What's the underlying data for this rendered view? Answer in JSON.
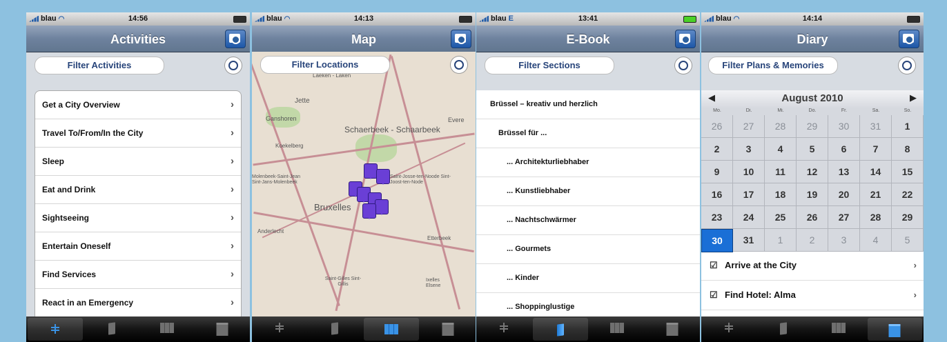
{
  "screens": [
    {
      "carrier": "blau",
      "time": "14:56",
      "title": "Activities",
      "filter": "Filter Activities",
      "items": [
        "Get a City Overview",
        "Travel To/From/In the City",
        "Sleep",
        "Eat and Drink",
        "Sightseeing",
        "Entertain Oneself",
        "Find Services",
        "React in an Emergency"
      ]
    },
    {
      "carrier": "blau",
      "time": "14:13",
      "title": "Map",
      "filter": "Filter Locations",
      "map_labels": [
        "Laeken - Laken",
        "Jette",
        "Ganshoren",
        "Schaerbeek - Schaarbeek",
        "Evere",
        "Koekelberg",
        "Molenbeek-Saint-Jean Sint-Jans-Molenbeek",
        "Saint-Josse-ten-Noode Sint-Joost-ten-Node",
        "Bruxelles",
        "Anderlecht",
        "Etterbeek",
        "Saint-Gilles Sint-Gillis",
        "Ixelles Elsene"
      ]
    },
    {
      "carrier": "blau",
      "network": "E",
      "time": "13:41",
      "title": "E-Book",
      "filter": "Filter Sections",
      "sections": [
        "Brüssel – kreativ und herzlich",
        "Brüssel für ...",
        "... Architekturliebhaber",
        "... Kunstliebhaber",
        "... Nachtschwärmer",
        "... Gourmets",
        "... Kinder",
        "... Shoppinglustige"
      ]
    },
    {
      "carrier": "blau",
      "time": "14:14",
      "title": "Diary",
      "filter": "Filter Plans & Memories",
      "calendar": {
        "month": "August 2010",
        "prev": "◀",
        "next": "▶",
        "weekdays": [
          "Mo.",
          "Di.",
          "Mi.",
          "Do.",
          "Fr.",
          "Sa.",
          "So."
        ],
        "days": [
          "26",
          "27",
          "28",
          "29",
          "30",
          "31",
          "1",
          "2",
          "3",
          "4",
          "5",
          "6",
          "7",
          "8",
          "9",
          "10",
          "11",
          "12",
          "13",
          "14",
          "15",
          "16",
          "17",
          "18",
          "19",
          "20",
          "21",
          "22",
          "23",
          "24",
          "25",
          "26",
          "27",
          "28",
          "29",
          "30",
          "31",
          "1",
          "2",
          "3",
          "4",
          "5"
        ],
        "selected": "30"
      },
      "entries": [
        "Arrive at the City",
        "Find Hotel: Alma"
      ]
    }
  ]
}
